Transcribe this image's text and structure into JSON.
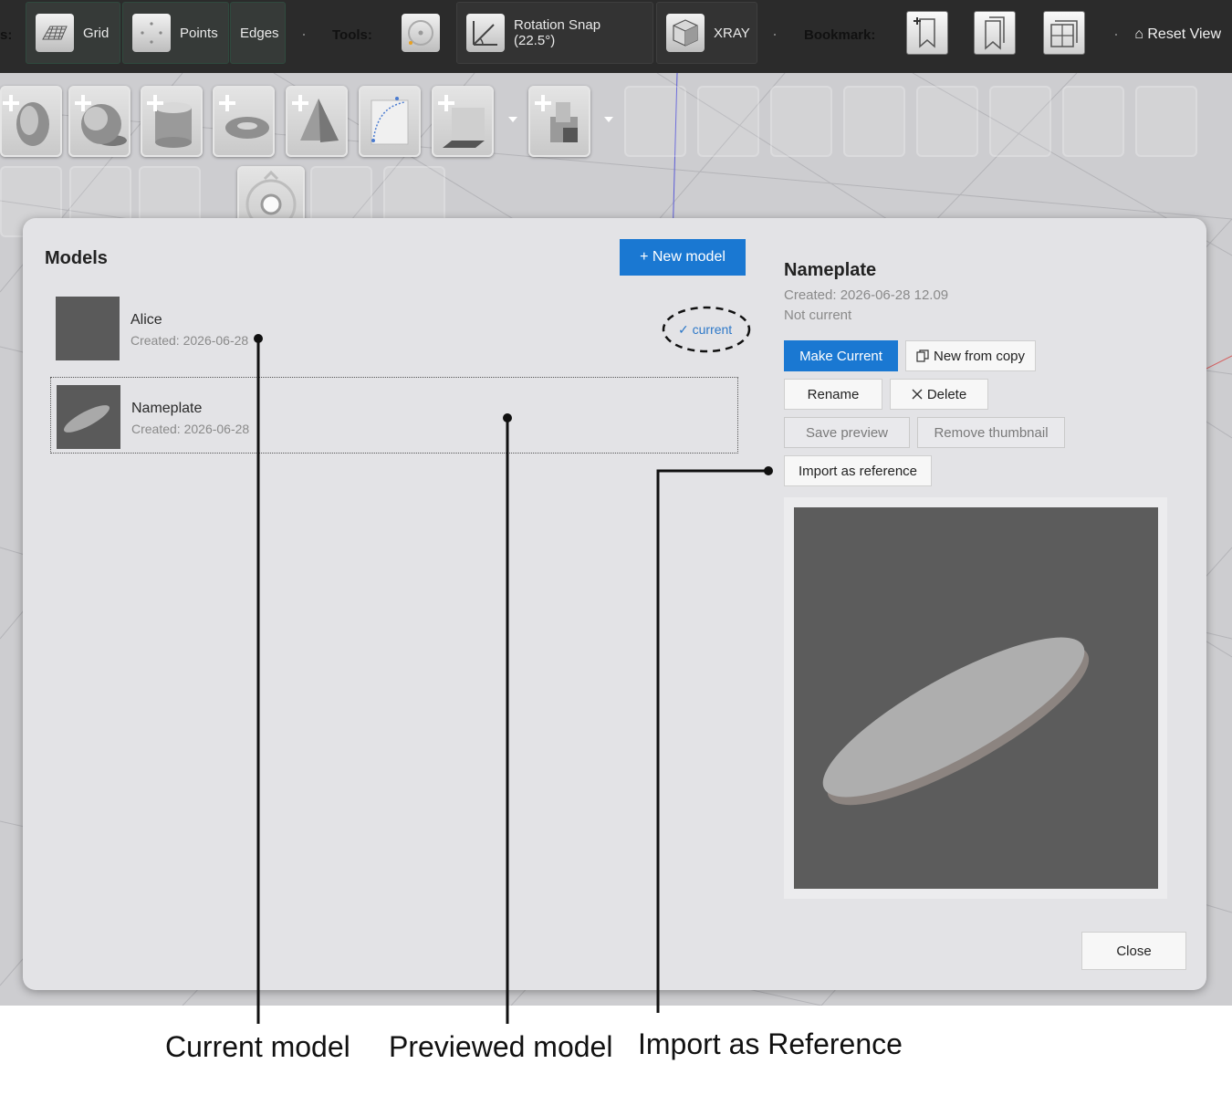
{
  "toolbar": {
    "grid_label": "Grid",
    "points_label": "Points",
    "edges_label": "Edges",
    "tools_label": "Tools:",
    "rotation_snap_label": "Rotation Snap (22.5°)",
    "xray_label": "XRAY",
    "bookmark_label": "Bookmark:",
    "reset_view_label": "⌂ Reset View",
    "truncated_prefix": "s:"
  },
  "shape_toolbar": {
    "icons": [
      "add-egg-icon",
      "add-sphere-icon",
      "add-cylinder-icon",
      "add-torus-icon",
      "add-cone-icon",
      "curve-icon",
      "add-box-icon",
      "add-composite-icon",
      "rotate-tool-icon"
    ]
  },
  "models_dialog": {
    "title": "Models",
    "new_model_label": "+ New model",
    "current_badge": "✓ current",
    "items": [
      {
        "name": "Alice",
        "created": "Created: 2026-06-28"
      },
      {
        "name": "Nameplate",
        "created": "Created: 2026-06-28"
      }
    ],
    "detail": {
      "name": "Nameplate",
      "created": "Created: 2026-06-28 12.09",
      "status": "Not current",
      "make_current_label": "Make Current",
      "new_from_copy_label": "New from copy",
      "rename_label": "Rename",
      "delete_label": "Delete",
      "save_preview_label": "Save preview",
      "remove_thumbnail_label": "Remove thumbnail",
      "import_reference_label": "Import as reference"
    },
    "close_label": "Close"
  },
  "annotations": {
    "current_model": "Current model",
    "previewed_model": "Previewed model",
    "import_reference": "Import as Reference"
  },
  "colors": {
    "accent": "#1a78d2",
    "toolbar_bg": "#2b2b2b",
    "viewport_bg": "#cdcdd0",
    "dialog_bg": "#e3e3e6"
  }
}
